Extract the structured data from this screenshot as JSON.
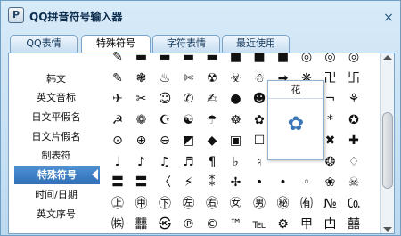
{
  "window": {
    "title": "QQ拼音符号输入器",
    "close_icon": "×",
    "logo_glyph": "P"
  },
  "tabs": [
    {
      "label": "QQ表情",
      "active": false
    },
    {
      "label": "特殊符号",
      "active": true
    },
    {
      "label": "字符表情",
      "active": false
    },
    {
      "label": "最近使用",
      "active": false
    }
  ],
  "sidebar": {
    "items": [
      {
        "label": "韩文",
        "active": false
      },
      {
        "label": "英文音标",
        "active": false
      },
      {
        "label": "日文平假名",
        "active": false
      },
      {
        "label": "日文片假名",
        "active": false
      },
      {
        "label": "制表符",
        "active": false
      },
      {
        "label": "特殊符号",
        "active": true
      },
      {
        "label": "时间/日期",
        "active": false
      },
      {
        "label": "英文序号",
        "active": false
      }
    ]
  },
  "symbols": [
    [
      "✎",
      "▬",
      "▬",
      "▬",
      "▬",
      "■",
      "■",
      "■",
      "◎",
      "◎",
      "◎"
    ],
    [
      "✎",
      "❃",
      "♨",
      "✄",
      "☢",
      "☣",
      "☃",
      "➡",
      "❋",
      "卍",
      "卐"
    ],
    [
      "✈",
      "✂",
      "☺",
      "✆",
      "✍",
      "●",
      "☻",
      "❀",
      "✁",
      "¬",
      "⚘"
    ],
    [
      "☭",
      "❁",
      "☪",
      "☯",
      "☂",
      "☸",
      "✿",
      "✽",
      "✺",
      "*",
      "✪"
    ],
    [
      "⊙",
      "⊕",
      "⊖",
      "◩",
      "◆",
      "▣",
      "☐",
      "✠",
      "✹",
      "✖",
      "✚"
    ],
    [
      "♩",
      "♪",
      "♫",
      "♬",
      "¶",
      "♭",
      "♮",
      "✇",
      "❁",
      "❂",
      "♢"
    ],
    [
      "〓",
      "〓",
      "〈",
      "⚡",
      "⁑",
      "✢",
      "•",
      "•",
      "◦",
      "❀",
      "☠"
    ],
    [
      "㊤",
      "㊥",
      "㊦",
      "㊧",
      "㊨",
      "㊛",
      "㊚",
      "㊙",
      "㈲",
      "№",
      "㏇"
    ],
    [
      "㈱",
      "䨻",
      "㉿",
      "℗",
      "©",
      "™",
      "℡",
      "⚙",
      "甲",
      "甴",
      "囍"
    ]
  ],
  "popup": {
    "label": "花",
    "symbol": "✿"
  },
  "icons": {
    "scroll_up": "chevron-up-icon",
    "scroll_down": "chevron-down-icon",
    "side_arrow": "triangle-left-icon"
  },
  "colors": {
    "accent": "#2f6fb8",
    "border": "#7aa3c8",
    "title": "#0c2d4e"
  }
}
